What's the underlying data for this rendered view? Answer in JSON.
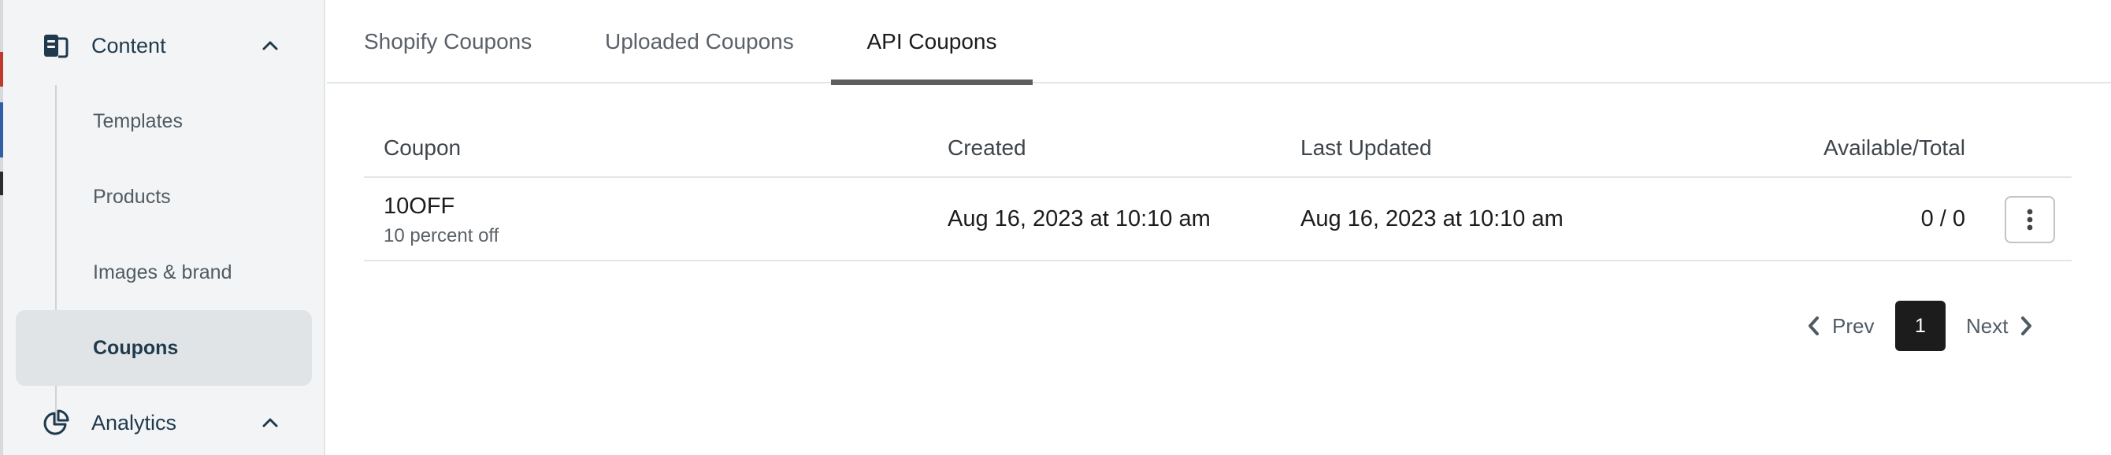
{
  "sidebar": {
    "sections": [
      {
        "label": "Content",
        "icon": "content-doc-icon",
        "expanded": true
      },
      {
        "label": "Analytics",
        "icon": "analytics-pie-icon",
        "expanded": true
      }
    ],
    "items": [
      {
        "label": "Templates"
      },
      {
        "label": "Products"
      },
      {
        "label": "Images & brand"
      },
      {
        "label": "Coupons",
        "active": true
      }
    ]
  },
  "tabs": [
    {
      "label": "Shopify Coupons"
    },
    {
      "label": "Uploaded Coupons"
    },
    {
      "label": "API Coupons",
      "active": true
    }
  ],
  "table": {
    "columns": [
      "Coupon",
      "Created",
      "Last Updated",
      "Available/Total"
    ],
    "rows": [
      {
        "name": "10OFF",
        "description": "10 percent off",
        "created": "Aug 16, 2023 at 10:10 am",
        "updated": "Aug 16, 2023 at 10:10 am",
        "available_total": "0 / 0"
      }
    ]
  },
  "pagination": {
    "prev_label": "Prev",
    "current_page": "1",
    "next_label": "Next"
  },
  "colors": {
    "sidebar_bg": "#f3f4f5",
    "active_item_bg": "#e0e4e7",
    "active_tab_indicator": "#5e5e5e",
    "current_page_bg": "#1c1c1c",
    "sidebar_text": "#1f3a4d"
  }
}
